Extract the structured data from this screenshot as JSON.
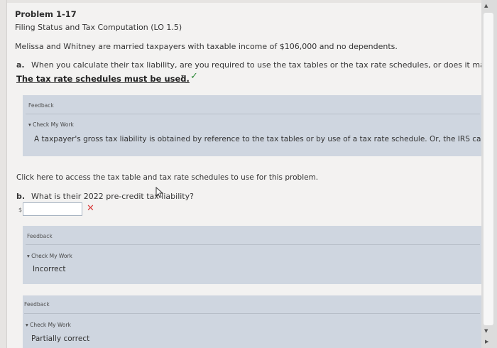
{
  "problem": {
    "title": "Problem 1-17",
    "subtitle": "Filing Status and Tax Computation (LO 1.5)",
    "intro": "Melissa and Whitney are married taxpayers with taxable income of $106,000 and no dependents."
  },
  "part_a": {
    "label": "a.",
    "question": "When you calculate their tax liability, are you required to use the tax tables or the tax rate schedules, or does it matter?",
    "answer": "The tax rate schedules must be used.",
    "status": "correct"
  },
  "feedback1": {
    "heading": "Feedback",
    "toggle": "Check My Work",
    "text": "A taxpayer's gross tax liability is obtained by reference to the tax tables or by use of a tax rate schedule. Or, the IRS can figu"
  },
  "link_text": "Click here to access the tax table and tax rate schedules to use for this problem.",
  "part_b": {
    "label": "b.",
    "question": "What is their 2022 pre-credit tax liability?",
    "currency": "$",
    "input_value": "",
    "status": "incorrect"
  },
  "feedback2": {
    "heading": "Feedback",
    "toggle": "Check My Work",
    "text": "Incorrect"
  },
  "feedback3": {
    "heading": "Feedback",
    "toggle": "Check My Work",
    "text": "Partially correct"
  },
  "icons": {
    "correct": "check-icon",
    "incorrect": "x-icon",
    "dropdown": "chevron-down-icon",
    "toggle": "triangle-down-icon"
  },
  "colors": {
    "feedback_bg": "#cfd6e0",
    "check": "#2e8b3a",
    "x": "#d83a3a"
  }
}
